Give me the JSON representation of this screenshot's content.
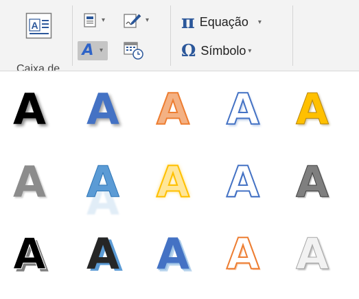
{
  "ribbon": {
    "textbox": {
      "label": "Caixa de",
      "icon": "text-box-icon"
    },
    "quick_parts": {
      "icon": "quick-parts-icon"
    },
    "signature": {
      "icon": "signature-line-icon"
    },
    "wordart": {
      "icon": "wordart-icon",
      "glyph": "A"
    },
    "datetime": {
      "icon": "date-time-icon"
    },
    "equation": {
      "glyph": "π",
      "label": "Equação",
      "icon": "pi-icon"
    },
    "symbol": {
      "glyph": "Ω",
      "label": "Símbolo",
      "icon": "omega-icon"
    }
  },
  "wordart_gallery": {
    "letter": "A",
    "styles": [
      [
        "black-fill-shadow",
        "blue-fill-shadow",
        "orange-fill-outline",
        "white-outline-blue",
        "gold-gradient"
      ],
      [
        "gray-gradient",
        "blue-reflection",
        "yellow-glow",
        "white-double-outline-blue",
        "gray-bevel"
      ],
      [
        "black-outline-shadow",
        "black-blue-shadow",
        "blue-3d",
        "white-orange-outline",
        "white-gray-bevel"
      ]
    ]
  },
  "colors": {
    "ribbon_bg": "#f3f3f3",
    "accent_blue": "#2b579a",
    "wordart_blue": "#4472c4",
    "wordart_orange": "#ed7d31",
    "wordart_gold": "#ffc000"
  }
}
